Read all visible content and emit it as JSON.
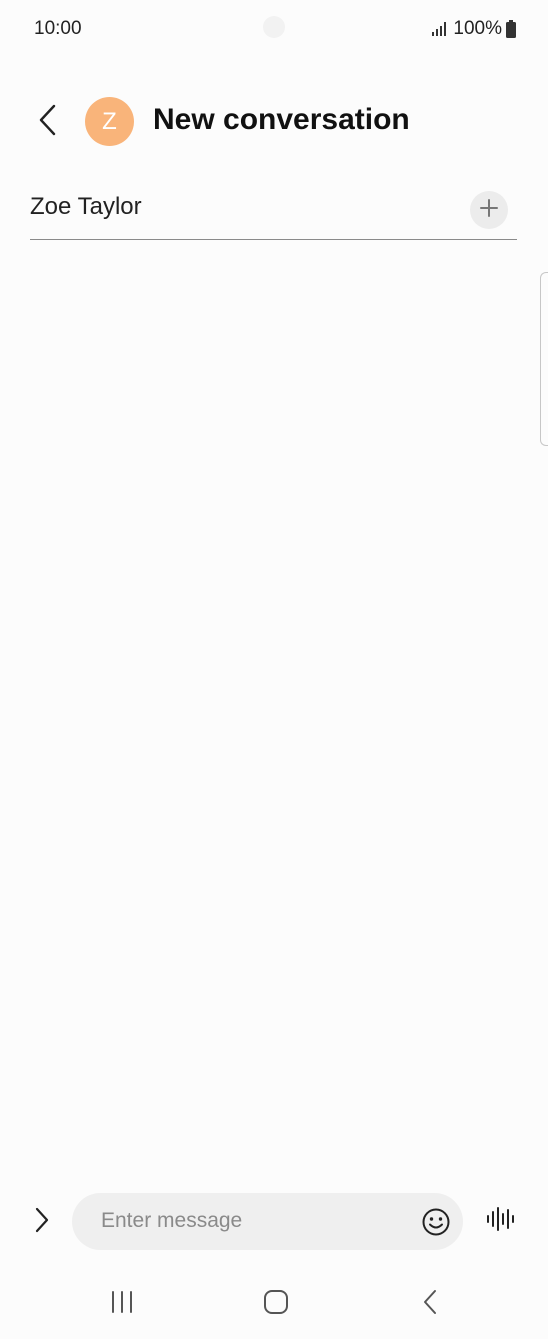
{
  "status_bar": {
    "time": "10:00",
    "battery": "100%",
    "icons": [
      "signal-icon",
      "battery-icon"
    ]
  },
  "header": {
    "back_icon": "chevron-left-icon",
    "avatar_letter": "Z",
    "avatar_color": "#f9b47a",
    "title": "New conversation"
  },
  "recipient": {
    "value": "Zoe Taylor",
    "add_icon": "plus-icon"
  },
  "composer": {
    "expand_icon": "chevron-right-icon",
    "placeholder": "Enter message",
    "emoji_icon": "smiley-icon",
    "voice_icon": "voice-waveform-icon"
  },
  "nav_bar": {
    "icons": [
      "recents-icon",
      "home-icon",
      "back-icon"
    ]
  }
}
